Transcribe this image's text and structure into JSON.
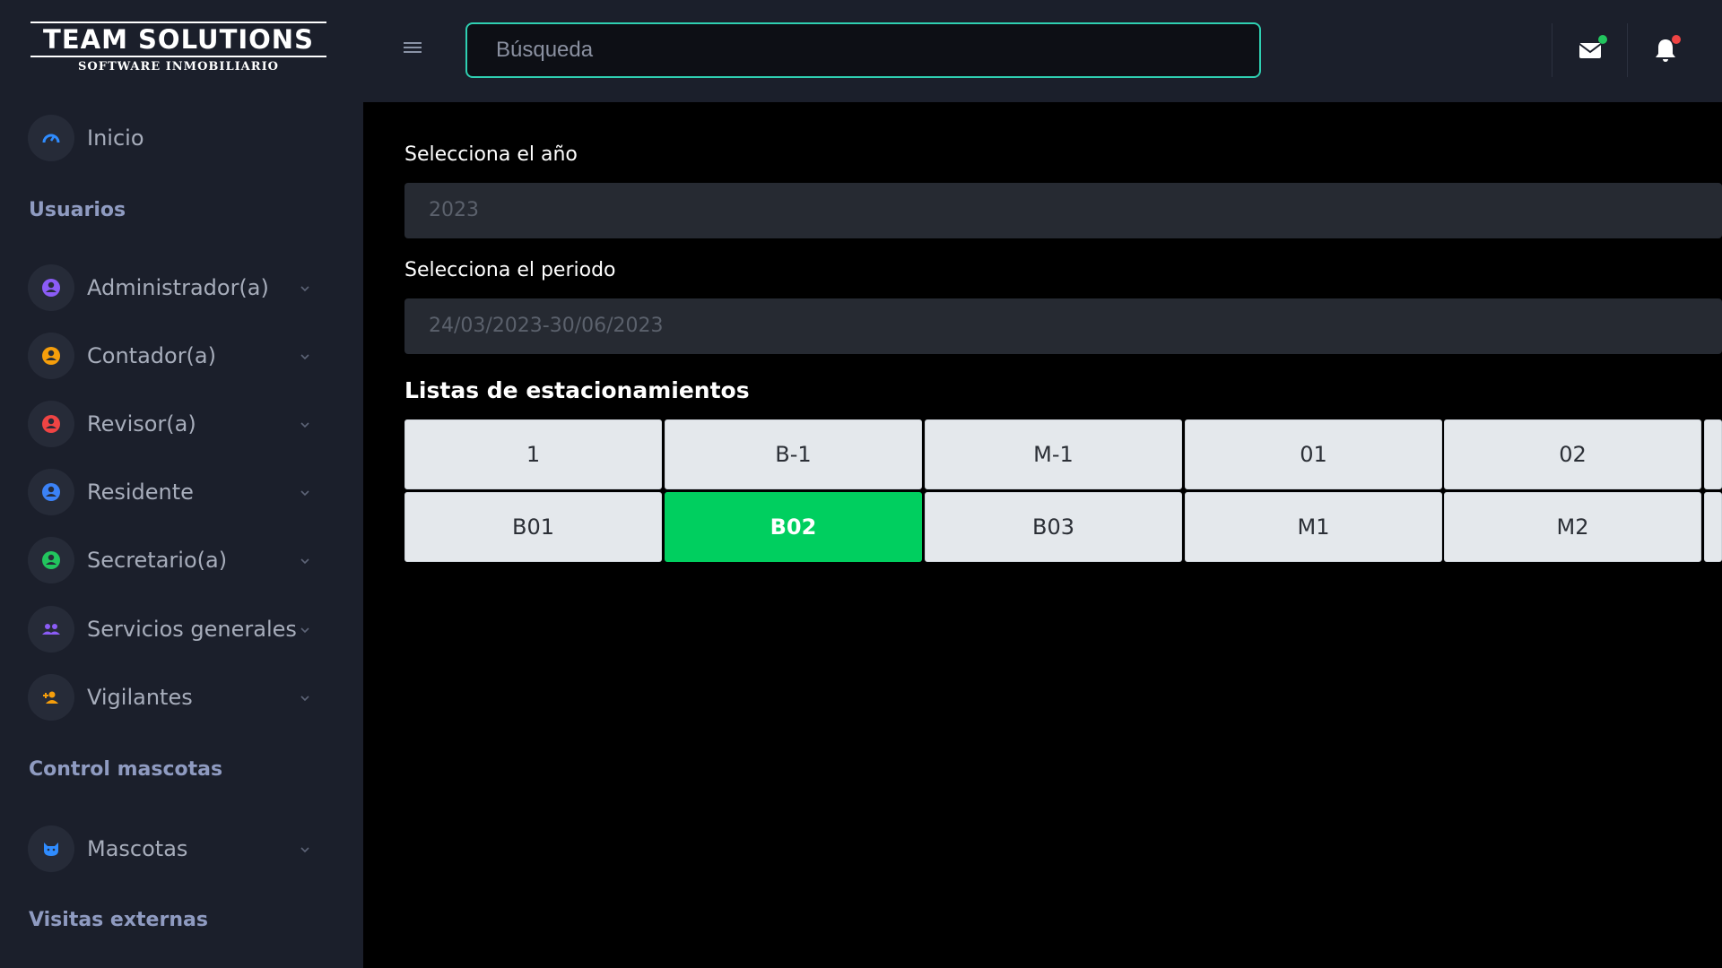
{
  "brand": {
    "name": "TEAM SOLUTIONS",
    "tagline": "SOFTWARE INMOBILIARIO"
  },
  "header": {
    "search_placeholder": "Búsqueda",
    "mail_dot_color": "#22c55e",
    "bell_dot_color": "#ef4444"
  },
  "sidebar": {
    "home": {
      "label": "Inicio",
      "icon": "speedometer-icon",
      "color": "#2f8cff"
    },
    "sections": [
      {
        "title": "Usuarios",
        "items": [
          {
            "label": "Administrador(a)",
            "icon": "user-circle-icon",
            "color": "#8b5cf6"
          },
          {
            "label": "Contador(a)",
            "icon": "user-circle-icon",
            "color": "#f59e0b"
          },
          {
            "label": "Revisor(a)",
            "icon": "user-circle-icon",
            "color": "#ef4444"
          },
          {
            "label": "Residente",
            "icon": "user-circle-icon",
            "color": "#3b82f6"
          },
          {
            "label": "Secretario(a)",
            "icon": "user-circle-icon",
            "color": "#22c55e"
          },
          {
            "label": "Servicios generales",
            "icon": "users-group-icon",
            "color": "#8b5cf6"
          },
          {
            "label": "Vigilantes",
            "icon": "user-plus-icon",
            "color": "#f59e0b"
          }
        ]
      },
      {
        "title": "Control mascotas",
        "items": [
          {
            "label": "Mascotas",
            "icon": "cat-icon",
            "color": "#2f8cff"
          }
        ]
      },
      {
        "title": "Visitas externas",
        "items": []
      }
    ]
  },
  "main": {
    "year_label": "Selecciona el año",
    "year_value": "2023",
    "period_label": "Selecciona el periodo",
    "period_value": "24/03/2023-30/06/2023",
    "list_title": "Listas de estacionamientos",
    "parking_rows": [
      [
        "1",
        "B-1",
        "M-1",
        "01",
        "02",
        ""
      ],
      [
        "B01",
        "B02",
        "B03",
        "M1",
        "M2",
        ""
      ]
    ],
    "active_spot": "B02",
    "active_color": "#00cf5f"
  }
}
